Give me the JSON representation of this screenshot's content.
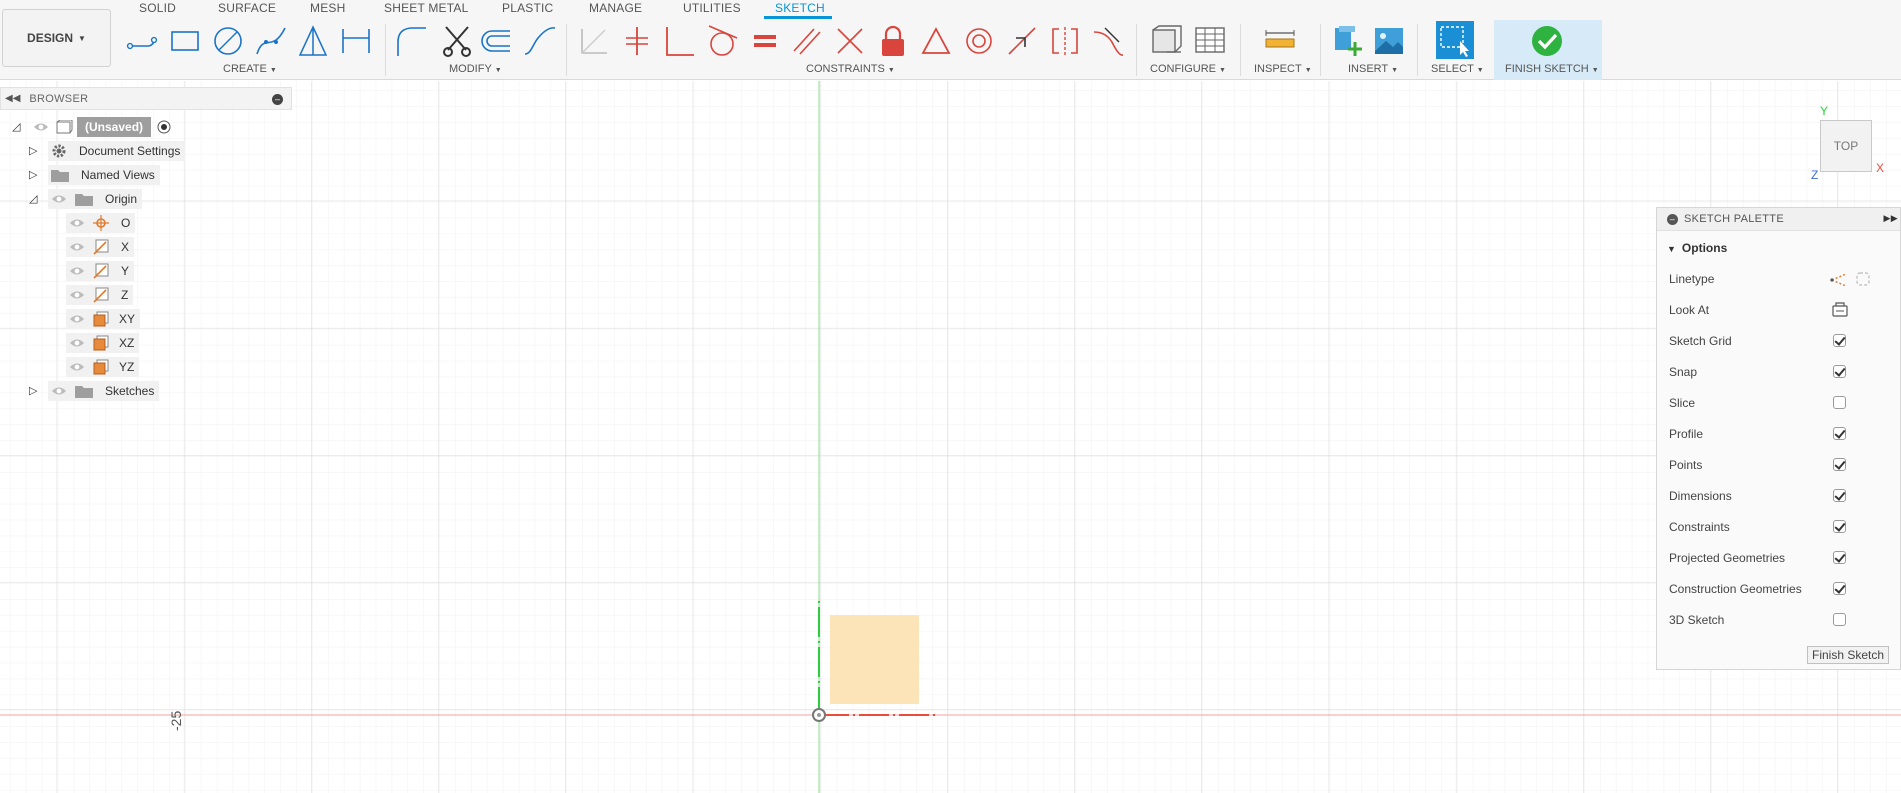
{
  "workspace_button": {
    "label": "DESIGN"
  },
  "tabs": [
    "SOLID",
    "SURFACE",
    "MESH",
    "SHEET METAL",
    "PLASTIC",
    "MANAGE",
    "UTILITIES",
    "SKETCH"
  ],
  "active_tab": "SKETCH",
  "groups": {
    "create": "CREATE",
    "modify": "MODIFY",
    "constraints": "CONSTRAINTS",
    "configure": "CONFIGURE",
    "inspect": "INSPECT",
    "insert": "INSERT",
    "select": "SELECT",
    "finish": "FINISH SKETCH"
  },
  "tool_icons": {
    "create": [
      "sketch-line-icon",
      "rectangle-icon",
      "circle-icon",
      "spline-icon",
      "triangle-icon",
      "dimension-icon"
    ],
    "modify": [
      "fillet-icon",
      "trim-scissors-icon",
      "offset-icon",
      "curve-icon"
    ],
    "constraints": [
      "constraint-ghost-icon",
      "perpendicular-icon",
      "horizontal-constraint-icon",
      "tangent-icon",
      "equal-icon",
      "parallel-icon",
      "perpendicular-cross-icon",
      "fix-lock-icon",
      "triangle-constraint-icon",
      "concentric-icon",
      "midpoint-icon",
      "symmetry-icon",
      "curvature-icon"
    ],
    "configure": [
      "parameters-icon",
      "configure-table-icon"
    ],
    "inspect": [
      "measure-ruler-icon"
    ],
    "insert": [
      "insert-derive-icon",
      "insert-image-icon"
    ],
    "select": [
      "select-window-icon"
    ],
    "finish": [
      "finish-check-icon"
    ]
  },
  "browser": {
    "title": "BROWSER",
    "root": "(Unsaved)",
    "items": [
      {
        "label": "Document Settings",
        "icon": "gear-icon"
      },
      {
        "label": "Named Views",
        "icon": "folder-icon"
      },
      {
        "label": "Origin",
        "icon": "folder-icon"
      },
      {
        "label": "O",
        "icon": "origin-point-icon"
      },
      {
        "label": "X",
        "icon": "axis-icon"
      },
      {
        "label": "Y",
        "icon": "axis-icon"
      },
      {
        "label": "Z",
        "icon": "axis-icon"
      },
      {
        "label": "XY",
        "icon": "plane-icon"
      },
      {
        "label": "XZ",
        "icon": "plane-icon"
      },
      {
        "label": "YZ",
        "icon": "plane-icon"
      },
      {
        "label": "Sketches",
        "icon": "folder-icon"
      }
    ]
  },
  "palette": {
    "title": "SKETCH PALETTE",
    "section": "Options",
    "options": [
      {
        "label": "Linetype",
        "control": "linetype-icons"
      },
      {
        "label": "Look At",
        "control": "look-at-icon"
      },
      {
        "label": "Sketch Grid",
        "checked": true
      },
      {
        "label": "Snap",
        "checked": true
      },
      {
        "label": "Slice",
        "checked": false
      },
      {
        "label": "Profile",
        "checked": true
      },
      {
        "label": "Points",
        "checked": true
      },
      {
        "label": "Dimensions",
        "checked": true
      },
      {
        "label": "Constraints",
        "checked": true
      },
      {
        "label": "Projected Geometries",
        "checked": true
      },
      {
        "label": "Construction Geometries",
        "checked": true
      },
      {
        "label": "3D Sketch",
        "checked": false
      }
    ],
    "finish_button": "Finish Sketch"
  },
  "viewcube": {
    "face": "TOP",
    "axis_x": "X",
    "axis_y": "Y",
    "axis_z": "Z"
  },
  "canvas": {
    "ruler_label": "-25"
  },
  "colors": {
    "accent": "#0696d7",
    "x_axis": "#e84c3d",
    "y_axis": "#2ecc40",
    "profile_fill": "#fde4b8",
    "constraint_red": "#d9453c"
  }
}
